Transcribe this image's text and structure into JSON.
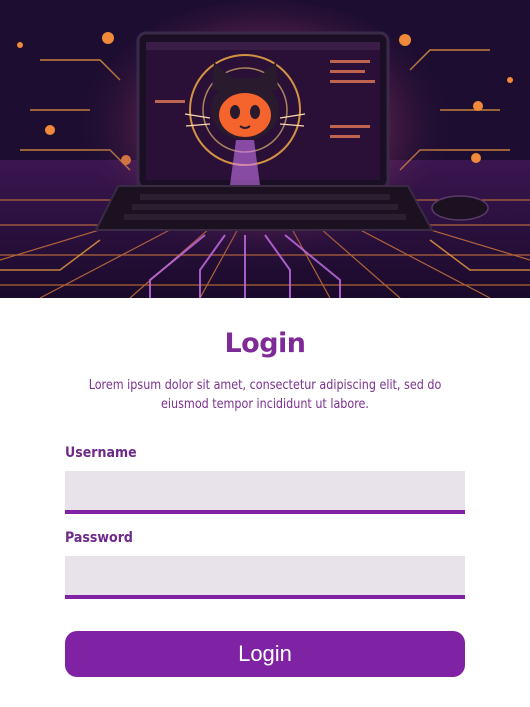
{
  "hero": {
    "image_description_icon": "cat-laptop-circuit-illustration"
  },
  "login": {
    "title": "Login",
    "subtitle": "Lorem ipsum dolor sit amet, consectetur adipiscing elit, sed do eiusmod tempor incididunt ut labore.",
    "username_label": "Username",
    "username_value": "",
    "password_label": "Password",
    "password_value": "",
    "button_label": "Login"
  },
  "colors": {
    "accent": "#7f22a4",
    "field_bg": "#e8e3ea",
    "text": "#7a3090"
  }
}
